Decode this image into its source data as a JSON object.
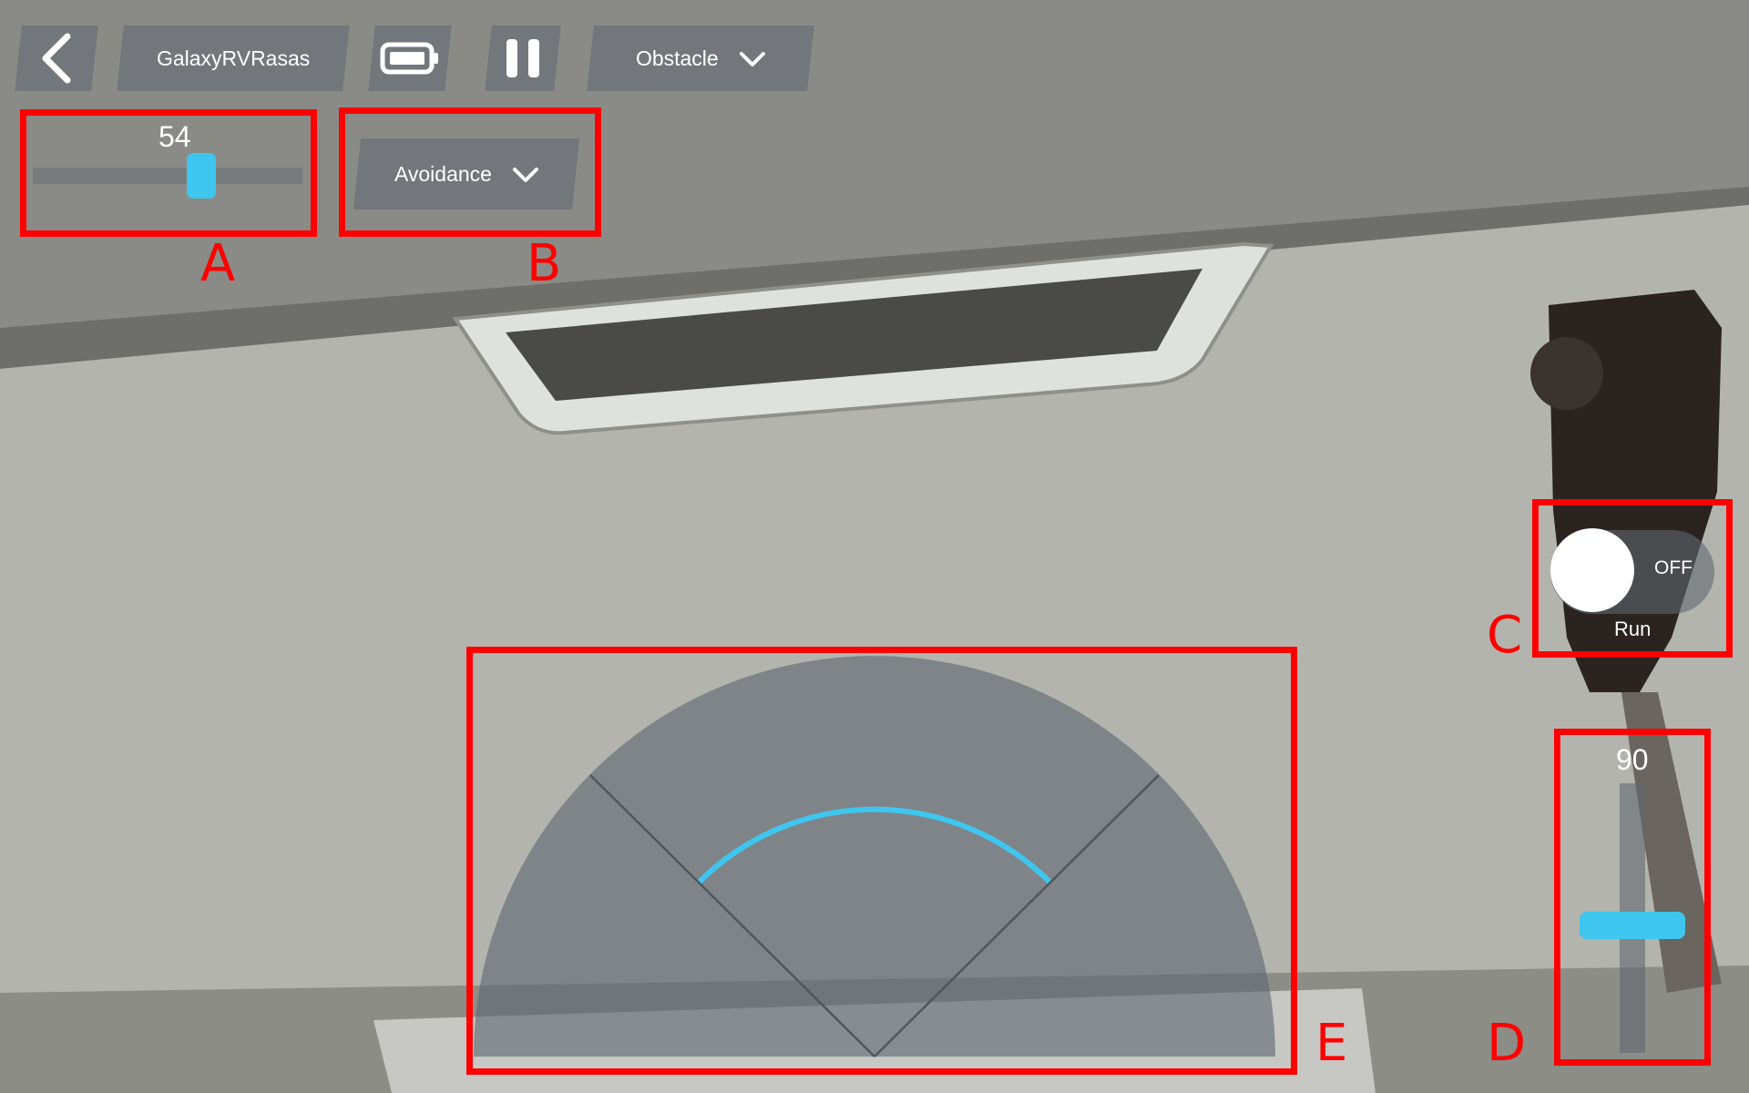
{
  "app": {
    "device_name": "GalaxyRVRasas",
    "back_icon": "chevron-left-icon",
    "battery_icon": "battery-icon",
    "pause_icon": "pause-icon"
  },
  "mode_dropdown": {
    "selected": "Obstacle",
    "icon": "chevron-down-icon"
  },
  "sub_mode_dropdown": {
    "selected": "Avoidance",
    "icon": "chevron-down-icon"
  },
  "speed_slider": {
    "value": "54",
    "fraction": 0.54
  },
  "run_toggle": {
    "state_label": "OFF",
    "caption": "Run",
    "on": false
  },
  "vertical_slider": {
    "value": "90",
    "fraction": 0.47
  },
  "radar": {
    "arc_color": "#3fc6ef"
  },
  "annotations": {
    "a": "A",
    "b": "B",
    "c": "C",
    "d": "D",
    "e": "E"
  },
  "colors": {
    "accent": "#3fc6ef",
    "annotation": "#ff0000",
    "panel": "#606872"
  }
}
